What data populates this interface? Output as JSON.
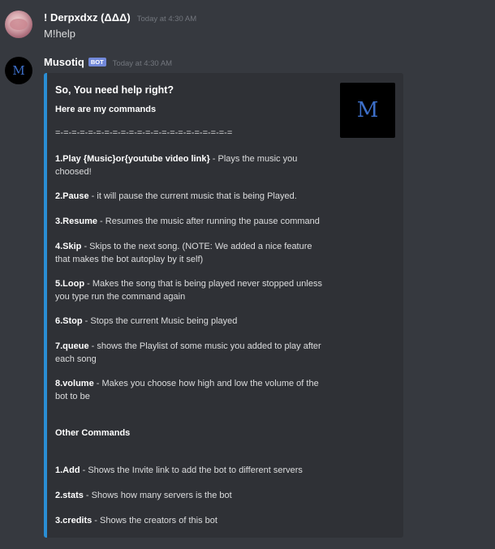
{
  "messages": [
    {
      "author": "! Derpxdxz (ΔΔΔ)",
      "timestamp": "Today at 4:30 AM",
      "text": "M!help"
    },
    {
      "author": "Musotiq",
      "badge": "BOT",
      "timestamp": "Today at 4:30 AM",
      "avatar_letter": "M"
    }
  ],
  "embed": {
    "title": "So, You need help right?",
    "subtitle": "Here are my commands",
    "separator": "=-=-=-=-=-=-=-=-=-=-=-=-=-=-=-=-=-=-=-=-=-=",
    "thumbnail_letter": "M",
    "accent_color": "#2a8ed4",
    "commands": [
      {
        "name": "1.Play {Music}or{youtube video link}",
        "desc": " - Plays the music you",
        "desc2": "choosed!"
      },
      {
        "name": "2.Pause",
        "desc": " - it will pause the current music that is being Played."
      },
      {
        "name": "3.Resume",
        "desc": " - Resumes the music after running the pause command"
      },
      {
        "name": "4.Skip",
        "desc": " - Skips to the next song. (NOTE: We added a nice feature",
        "desc2": "that makes the bot autoplay by it self)"
      },
      {
        "name": "5.Loop",
        "desc": " - Makes the song that is being played never stopped unless",
        "desc2": "you type run the command again"
      },
      {
        "name": "6.Stop",
        "desc": " - Stops the current Music being played"
      },
      {
        "name": "7.queue",
        "desc": " - shows the Playlist of some music you added to play after",
        "desc2": "each song"
      },
      {
        "name": "8.volume",
        "desc": " - Makes you choose how high and low the volume of the",
        "desc2": "bot to be"
      }
    ],
    "other_title": "Other Commands",
    "other_commands": [
      {
        "name": "1.Add",
        "desc": " - Shows the Invite link to add the bot to different servers"
      },
      {
        "name": "2.stats",
        "desc": " - Shows how many servers is the bot"
      },
      {
        "name": "3.credits",
        "desc": " - Shows the creators of this bot"
      }
    ]
  }
}
